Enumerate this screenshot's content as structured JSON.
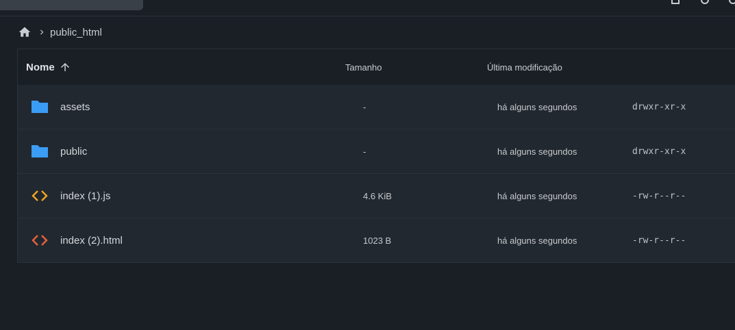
{
  "breadcrumb": {
    "home_icon": "home-icon",
    "separator_icon": "chevron-right-icon",
    "current": "public_html"
  },
  "table": {
    "headers": {
      "name": "Nome",
      "size": "Tamanho",
      "modified": "Última modificação"
    },
    "sort_icon": "arrow-up-icon",
    "rows": [
      {
        "name": "assets",
        "size": "-",
        "modified": "há alguns segundos",
        "permissions": "drwxr-xr-x",
        "icon": "folder-icon",
        "icon_color": "#3b9cf5"
      },
      {
        "name": "public",
        "size": "-",
        "modified": "há alguns segundos",
        "permissions": "drwxr-xr-x",
        "icon": "folder-icon",
        "icon_color": "#3b9cf5"
      },
      {
        "name": "index (1).js",
        "size": "4.6 KiB",
        "modified": "há alguns segundos",
        "permissions": "-rw-r--r--",
        "icon": "code-icon",
        "icon_color": "#f5a623"
      },
      {
        "name": "index (2).html",
        "size": "1023 B",
        "modified": "há alguns segundos",
        "permissions": "-rw-r--r--",
        "icon": "code-icon",
        "icon_color": "#e8643c"
      }
    ]
  },
  "colors": {
    "background": "#1a1f25",
    "row_background": "#22282f",
    "folder": "#3b9cf5",
    "js": "#f5a623",
    "html": "#e8643c"
  }
}
